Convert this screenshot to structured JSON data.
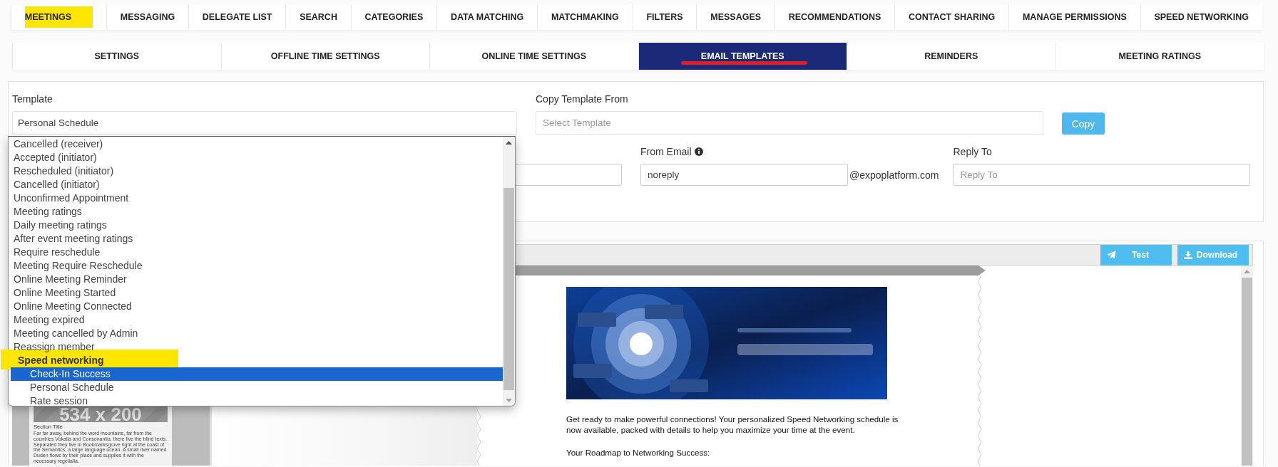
{
  "top_nav": [
    {
      "label": "MEETINGS",
      "highlighted": true
    },
    {
      "label": "MESSAGING",
      "highlighted": false
    },
    {
      "label": "DELEGATE LIST",
      "highlighted": false
    },
    {
      "label": "SEARCH",
      "highlighted": false
    },
    {
      "label": "CATEGORIES",
      "highlighted": false
    },
    {
      "label": "DATA MATCHING",
      "highlighted": false
    },
    {
      "label": "MATCHMAKING",
      "highlighted": false
    },
    {
      "label": "FILTERS",
      "highlighted": false
    },
    {
      "label": "MESSAGES",
      "highlighted": false
    },
    {
      "label": "RECOMMENDATIONS",
      "highlighted": false
    },
    {
      "label": "CONTACT SHARING",
      "highlighted": false
    },
    {
      "label": "MANAGE PERMISSIONS",
      "highlighted": false
    },
    {
      "label": "SPEED NETWORKING",
      "highlighted": false
    }
  ],
  "sub_tabs": [
    {
      "label": "SETTINGS",
      "selected": false,
      "underlined": false
    },
    {
      "label": "OFFLINE TIME SETTINGS",
      "selected": false,
      "underlined": false
    },
    {
      "label": "ONLINE TIME SETTINGS",
      "selected": false,
      "underlined": false
    },
    {
      "label": "EMAIL TEMPLATES",
      "selected": true,
      "underlined": true
    },
    {
      "label": "REMINDERS",
      "selected": false,
      "underlined": false
    },
    {
      "label": "MEETING RATINGS",
      "selected": false,
      "underlined": false
    }
  ],
  "form": {
    "template": {
      "label": "Template",
      "value": "Personal Schedule"
    },
    "copy_template_from": {
      "label": "Copy Template From",
      "placeholder": "Select Template"
    },
    "copy_button": "Copy",
    "from_email": {
      "label": "From Email",
      "value": "noreply",
      "suffix": "@expoplatform.com"
    },
    "reply_to": {
      "label": "Reply To",
      "placeholder": "Reply To"
    }
  },
  "template_dropdown": {
    "items": [
      {
        "kind": "option",
        "label": "Cancelled (receiver)",
        "selected": false,
        "highlighted": false
      },
      {
        "kind": "option",
        "label": "Accepted (initiator)",
        "selected": false,
        "highlighted": false
      },
      {
        "kind": "option",
        "label": "Rescheduled (initiator)",
        "selected": false,
        "highlighted": false
      },
      {
        "kind": "option",
        "label": "Cancelled (initiator)",
        "selected": false,
        "highlighted": false
      },
      {
        "kind": "option",
        "label": "Unconfirmed Appointment",
        "selected": false,
        "highlighted": false
      },
      {
        "kind": "option",
        "label": "Meeting ratings",
        "selected": false,
        "highlighted": false
      },
      {
        "kind": "option",
        "label": "Daily meeting ratings",
        "selected": false,
        "highlighted": false
      },
      {
        "kind": "option",
        "label": "After event meeting ratings",
        "selected": false,
        "highlighted": false
      },
      {
        "kind": "option",
        "label": "Require reschedule",
        "selected": false,
        "highlighted": false
      },
      {
        "kind": "option",
        "label": "Meeting Require Reschedule",
        "selected": false,
        "highlighted": false
      },
      {
        "kind": "option",
        "label": "Online Meeting Reminder",
        "selected": false,
        "highlighted": false
      },
      {
        "kind": "option",
        "label": "Online Meeting Started",
        "selected": false,
        "highlighted": false
      },
      {
        "kind": "option",
        "label": "Online Meeting Connected",
        "selected": false,
        "highlighted": false
      },
      {
        "kind": "option",
        "label": "Meeting expired",
        "selected": false,
        "highlighted": false
      },
      {
        "kind": "option",
        "label": "Meeting cancelled by Admin",
        "selected": false,
        "highlighted": false
      },
      {
        "kind": "option",
        "label": "Reassign member",
        "selected": false,
        "highlighted": false
      },
      {
        "kind": "group",
        "label": "Speed networking",
        "highlighted": true,
        "children": [
          {
            "label": "Check-In Success",
            "selected": true
          },
          {
            "label": "Personal Schedule",
            "selected": false
          },
          {
            "label": "Rate session",
            "selected": false
          }
        ]
      }
    ]
  },
  "preview": {
    "toolbar_buttons": [
      {
        "label": "Test",
        "kind": "send"
      },
      {
        "label": "Download",
        "kind": "download"
      }
    ],
    "thumbnail": {
      "placeholder": "534 x 200",
      "title": "Section Title",
      "text": "Far far away, behind the word mountains, far from the countries Vokalia and Consonantia, there live the blind texts. Separated they live in Bookmarksgrove right at the coast of the Semantics, a large language ocean. A small river named Duden flows by their place and supplies it with the necessary regelialia."
    },
    "email": {
      "banner": {
        "kind": "picture"
      },
      "paragraphs": [
        "Get ready to make powerful connections! Your personalized Speed Networking schedule is now available, packed with details to help you maximize your time at the event.",
        "Your Roadmap to Networking Success:"
      ]
    }
  }
}
